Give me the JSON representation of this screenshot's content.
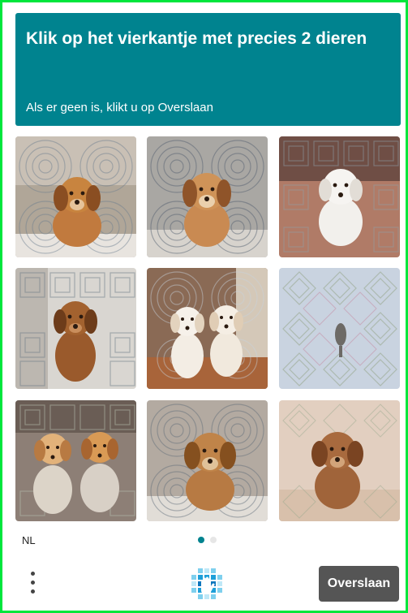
{
  "header": {
    "title": "Klik op het vierkantje met precies 2 dieren",
    "subtitle": "Als er geen is, klikt u op Overslaan"
  },
  "colors": {
    "accent": "#00838f",
    "skip_button": "#555555",
    "frame_border": "#00e63c"
  },
  "grid": {
    "tiles": [
      {
        "name": "tile-1",
        "content": "one puppy",
        "pattern": "rings",
        "background": "#b0a698"
      },
      {
        "name": "tile-2",
        "content": "one puppy",
        "pattern": "rings",
        "background": "#a9a7a3"
      },
      {
        "name": "tile-3",
        "content": "one white puppy",
        "pattern": "squares",
        "background": "#b07b67"
      },
      {
        "name": "tile-4",
        "content": "one puppy",
        "pattern": "squares",
        "background": "#d9d6d1"
      },
      {
        "name": "tile-5",
        "content": "two puppies",
        "pattern": "rings",
        "background": "#8a6a55"
      },
      {
        "name": "tile-6",
        "content": "no animal",
        "pattern": "diamonds",
        "background": "#c9d3e0"
      },
      {
        "name": "tile-7",
        "content": "two puppies",
        "pattern": "squares",
        "background": "#8d7f76"
      },
      {
        "name": "tile-8",
        "content": "one puppy",
        "pattern": "rings",
        "background": "#b3aaa1"
      },
      {
        "name": "tile-9",
        "content": "one puppy",
        "pattern": "diamonds",
        "background": "#e2cfc0"
      }
    ]
  },
  "footer": {
    "language": "NL",
    "page_indicator": {
      "current": 1,
      "total": 2
    },
    "menu_icon": "more-vertical-icon",
    "logo_icon": "hcaptcha-hand-icon",
    "skip_label": "Overslaan"
  }
}
